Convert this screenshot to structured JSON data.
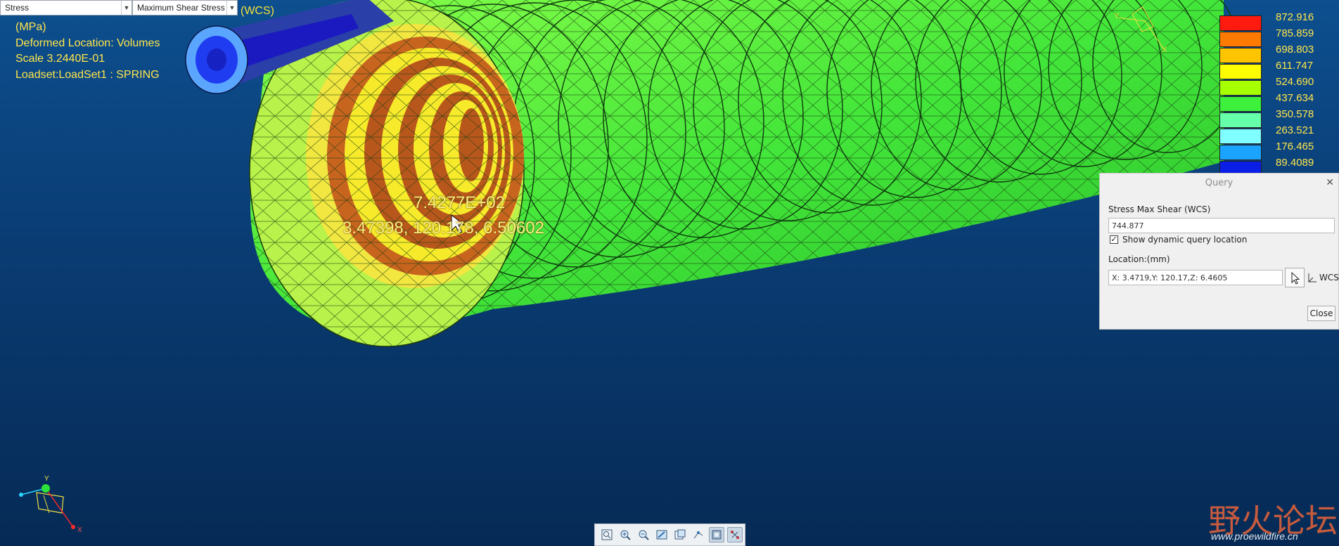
{
  "header": {
    "result_type": "Stress",
    "component": "Maximum Shear Stress",
    "coord_system": "(WCS)"
  },
  "info": {
    "units": "(MPa)",
    "deformed": "Deformed Location: Volumes",
    "scale": "Scale  3.2440E-01",
    "loadset": "Loadset:LoadSet1 :  SPRING"
  },
  "model_label": {
    "value": "7.4277E+02",
    "coords": "3.47398, 120.178, 6.50602"
  },
  "legend": {
    "entries": [
      {
        "label": "872.916",
        "color": "#ff1a0f"
      },
      {
        "label": "785.859",
        "color": "#ff7a00"
      },
      {
        "label": "698.803",
        "color": "#ffc400"
      },
      {
        "label": "611.747",
        "color": "#ffff00"
      },
      {
        "label": "524.690",
        "color": "#a8ff00"
      },
      {
        "label": "437.634",
        "color": "#3cf03c"
      },
      {
        "label": "350.578",
        "color": "#66ffaa"
      },
      {
        "label": "263.521",
        "color": "#7fffff"
      },
      {
        "label": "176.465",
        "color": "#1aa3ff"
      },
      {
        "label": "89.4089",
        "color": "#0a1ee6"
      },
      {
        "label": "",
        "color": "#14145a"
      }
    ]
  },
  "query": {
    "title": "Query",
    "value_label": "Stress Max Shear (WCS)",
    "value": "744.877",
    "checkbox_label": "Show dynamic query location",
    "checkbox_checked": true,
    "location_label": "Location:(mm)",
    "location": "X: 3.4719,Y: 120.17,Z: 6.4605",
    "wcs": "WCS",
    "close": "Close"
  },
  "toolbar": {
    "items": [
      "refit-icon",
      "zoom-in-icon",
      "zoom-out-icon",
      "repaint-icon",
      "saved-views-icon",
      "spin-center-icon",
      "display-style-icon",
      "annotations-icon"
    ]
  },
  "watermark": {
    "text": "野火论坛",
    "url": "www.proewildfire.cn"
  }
}
